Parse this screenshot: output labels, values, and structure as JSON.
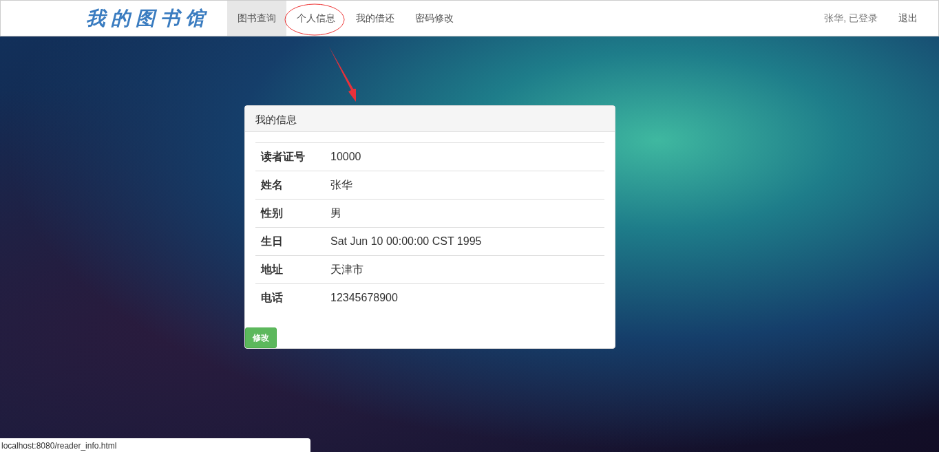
{
  "brand": "我的图书馆",
  "nav_items": [
    {
      "label": "图书查询",
      "selected": true
    },
    {
      "label": "个人信息",
      "selected": false
    },
    {
      "label": "我的借还",
      "selected": false
    },
    {
      "label": "密码修改",
      "selected": false
    }
  ],
  "user_status": "张华, 已登录",
  "logout": "退出",
  "panel": {
    "title": "我的信息",
    "rows": [
      {
        "label": "读者证号",
        "value": "10000"
      },
      {
        "label": "姓名",
        "value": "张华"
      },
      {
        "label": "性别",
        "value": "男"
      },
      {
        "label": "生日",
        "value": "Sat Jun 10 00:00:00 CST 1995"
      },
      {
        "label": "地址",
        "value": "天津市"
      },
      {
        "label": "电话",
        "value": "12345678900"
      }
    ],
    "edit_button": "修改"
  },
  "status_url": "localhost:8080/reader_info.html"
}
